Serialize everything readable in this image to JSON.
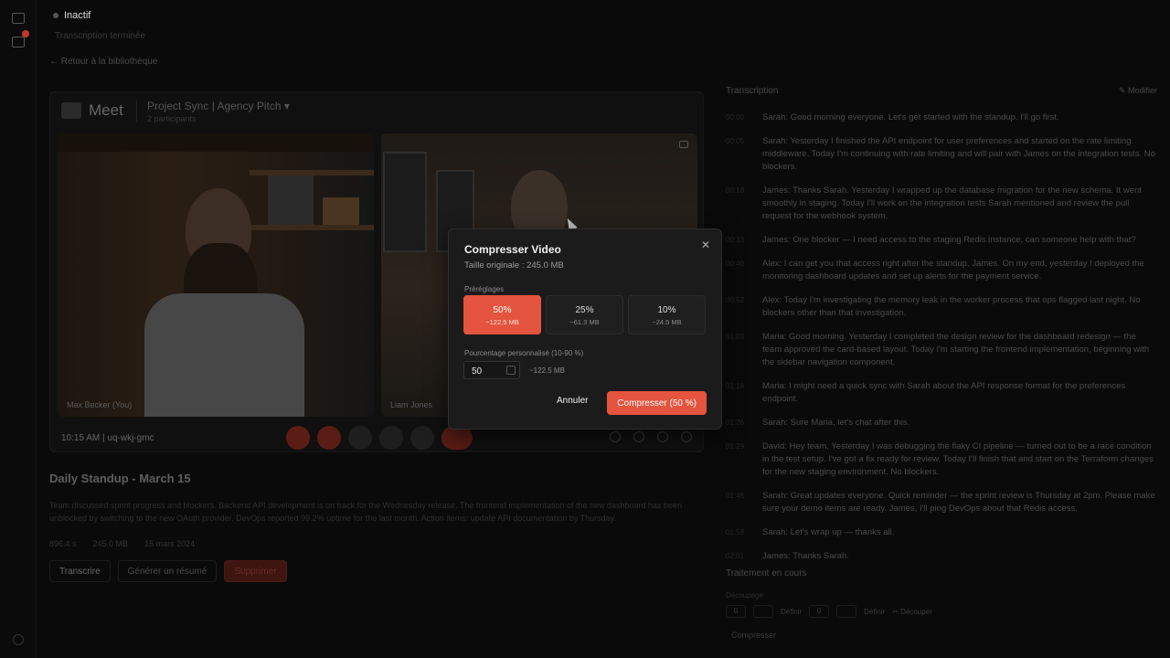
{
  "rail": {
    "icons": [
      "video-icon",
      "list-icon"
    ],
    "notification_color": "#c0392b"
  },
  "header": {
    "status": "Inactif",
    "status_sub": "Transcription terminée",
    "back_link": "← Retour à la bibliothèque"
  },
  "meet": {
    "logo": "Meet",
    "title": "Project Sync | Agency Pitch ▾",
    "participants": "2 participants",
    "time": "10:15 AM  |  uq-wkj-gmc",
    "tiles": [
      {
        "name": "Max Becker (You)"
      },
      {
        "name": "Liam Jones"
      }
    ]
  },
  "recording": {
    "title": "Daily Standup - March 15",
    "description": "Team discussed sprint progress and blockers. Backend API development is on track for the Wednesday release. The frontend implementation of the new dashboard has been unblocked by switching to the new OAuth provider. DevOps reported 99.2% uptime for the last month. Action items: update API documentation by Thursday.",
    "meta": [
      "896.4 s",
      "245.0 MB",
      "15 mars 2024"
    ],
    "actions": {
      "transcribe": "Transcrire",
      "generate": "Générer un résumé",
      "delete": "Supprimer"
    }
  },
  "transcript": {
    "heading": "Transcription",
    "edit": "✎ Modifier",
    "segments": [
      {
        "ts": "00:00",
        "text": "Sarah: Good morning everyone. Let's get started with the standup. I'll go first."
      },
      {
        "ts": "00:05",
        "text": "Sarah: Yesterday I finished the API endpoint for user preferences and started on the rate limiting middleware. Today I'm continuing with rate limiting and will pair with James on the integration tests. No blockers."
      },
      {
        "ts": "00:18",
        "text": "James: Thanks Sarah. Yesterday I wrapped up the database migration for the new schema. It went smoothly in staging. Today I'll work on the integration tests Sarah mentioned and review the pull request for the webhook system."
      },
      {
        "ts": "00:33",
        "text": "James: One blocker — I need access to the staging Redis instance, can someone help with that?"
      },
      {
        "ts": "00:40",
        "text": "Alex: I can get you that access right after the standup, James. On my end, yesterday I deployed the monitoring dashboard updates and set up alerts for the payment service."
      },
      {
        "ts": "00:52",
        "text": "Alex: Today I'm investigating the memory leak in the worker process that ops flagged last night. No blockers other than that investigation."
      },
      {
        "ts": "01:03",
        "text": "Maria: Good morning. Yesterday I completed the design review for the dashboard redesign — the team approved the card-based layout. Today I'm starting the frontend implementation, beginning with the sidebar navigation component."
      },
      {
        "ts": "01:18",
        "text": "Maria: I might need a quick sync with Sarah about the API response format for the preferences endpoint."
      },
      {
        "ts": "01:26",
        "text": "Sarah: Sure Maria, let's chat after this."
      },
      {
        "ts": "01:29",
        "text": "David: Hey team. Yesterday I was debugging the flaky CI pipeline — turned out to be a race condition in the test setup. I've got a fix ready for review. Today I'll finish that and start on the Terraform changes for the new staging environment. No blockers."
      },
      {
        "ts": "01:46",
        "text": "Sarah: Great updates everyone. Quick reminder — the sprint review is Thursday at 2pm. Please make sure your demo items are ready. James, I'll ping DevOps about that Redis access."
      },
      {
        "ts": "01:58",
        "text": "Sarah: Let's wrap up — thanks all."
      },
      {
        "ts": "02:01",
        "text": "James: Thanks Sarah."
      }
    ]
  },
  "processing": {
    "heading": "Traitement en cours",
    "sub": "Découpage",
    "start_value": "0",
    "start_define": "Définir",
    "end_value": "0",
    "end_define": "Définir",
    "cut_label": "✂ Découper",
    "compress_label": "Compresser"
  },
  "modal": {
    "title": "Compresser Video",
    "original_size": "Taille originale : 245.0 MB",
    "presets_label": "Préréglages",
    "presets": [
      {
        "pct": "50%",
        "mb": "~122.5 MB",
        "active": true
      },
      {
        "pct": "25%",
        "mb": "~61.3 MB",
        "active": false
      },
      {
        "pct": "10%",
        "mb": "~24.5 MB",
        "active": false
      }
    ],
    "custom_label": "Pourcentage personnalisé (10-90 %)",
    "custom_value": "50",
    "custom_mb": "~122.5 MB",
    "cancel": "Annuler",
    "submit": "Compresser (50 %)",
    "close": "✕",
    "accent_color": "#e4543e"
  }
}
